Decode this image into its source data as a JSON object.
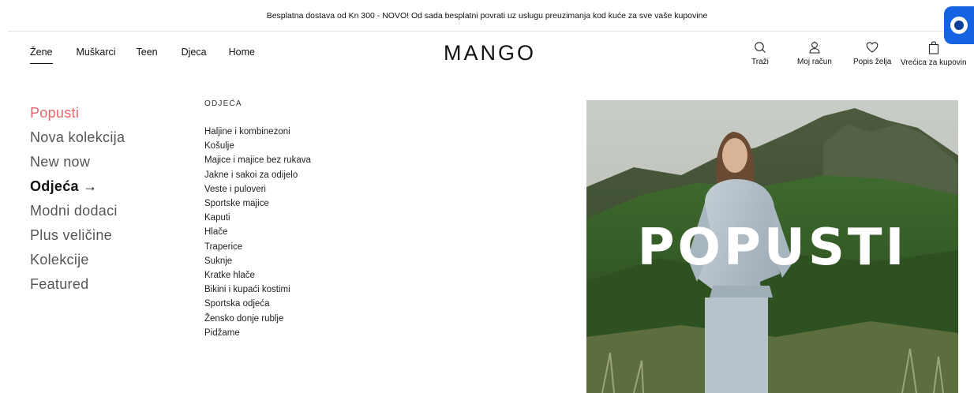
{
  "promo": {
    "text": "Besplatna dostava od Kn 300 - NOVO! Od sada besplatni povrati uz uslugu preuzimanja kod kuće za sve vaše kupovine"
  },
  "nav": {
    "items": [
      "Žene",
      "Muškarci",
      "Teen",
      "Djeca",
      "Home"
    ],
    "active": "Žene"
  },
  "logo": "MANGO",
  "utility": {
    "search": "Traži",
    "account": "Moj račun",
    "wishlist": "Popis želja",
    "bag": "Vrećica za kupovin"
  },
  "categories": [
    "Popusti",
    "Nova kolekcija",
    "New now",
    "Odjeća →",
    "Modni dodaci",
    "Plus veličine",
    "Kolekcije",
    "Featured"
  ],
  "submenu": {
    "heading": "ODJEĆA",
    "items": [
      "Haljine i kombinezoni",
      "Košulje",
      "Majice i majice bez rukava",
      "Jakne i sakoi za odijelo",
      "Veste i puloveri",
      "Sportske majice",
      "Kaputi",
      "Hlače",
      "Traperice",
      "Suknje",
      "Kratke hlače",
      "Bikini i kupaći kostimi",
      "Sportska odjeća",
      "Žensko donje rublje",
      "Pidžame"
    ]
  },
  "hero": {
    "title": "POPUSTI"
  },
  "icons": {
    "search": "search-icon",
    "account": "user-icon",
    "wishlist": "heart-icon",
    "bag": "shopping-bag-icon",
    "badge": "app-badge-icon"
  },
  "colors": {
    "sale": "#e8656c",
    "badge": "#1463e3"
  }
}
